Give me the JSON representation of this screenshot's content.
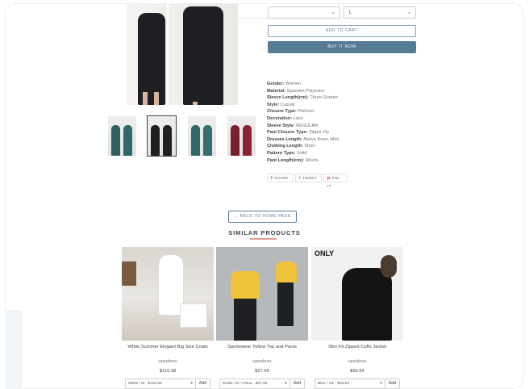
{
  "variant": {
    "color_select": "",
    "size_select": "L"
  },
  "buttons": {
    "add_to_cart": "ADD TO CART",
    "buy_now": "BUY IT NOW",
    "back_to_home": "← BACK TO HOME PAGE"
  },
  "specs": [
    {
      "label": "Gender:",
      "value": "Women"
    },
    {
      "label": "Material:",
      "value": "Spandex,Polyester"
    },
    {
      "label": "Sleeve Length(cm):",
      "value": "Three Quarter"
    },
    {
      "label": "Style:",
      "value": "Casual"
    },
    {
      "label": "Closure Type:",
      "value": "Pullover"
    },
    {
      "label": "Decoration:",
      "value": "Lace"
    },
    {
      "label": "Sleeve Style:",
      "value": "REGULAR"
    },
    {
      "label": "Pant Closure Type:",
      "value": "Zipper Fly"
    },
    {
      "label": "Dresses Length:",
      "value": "Above Knee, Mini"
    },
    {
      "label": "Clothing Length:",
      "value": "Short"
    },
    {
      "label": "Pattern Type:",
      "value": "Solid"
    },
    {
      "label": "Pant Length(cm):",
      "value": "Shorts"
    }
  ],
  "share": [
    {
      "icon": "facebook-icon",
      "glyph": "f",
      "label": "SHARE"
    },
    {
      "icon": "twitter-icon",
      "glyph": "t",
      "label": "TWEET"
    },
    {
      "icon": "pinterest-icon",
      "glyph": "p",
      "label": "PIN IT"
    }
  ],
  "similar": {
    "title": "SIMILAR PRODUCTS",
    "products": [
      {
        "name": "White Summer Elegant Big Size Coats",
        "vendor": "upsalezo",
        "price": "$115.38",
        "option": "White / M - $115.38",
        "add": "Add"
      },
      {
        "name": "Sportswear Yellow Top and Pants",
        "vendor": "upsalezo",
        "price": "$27.60",
        "option": "Khaki / M / China - $27.60",
        "add": "Add"
      },
      {
        "name": "Slim Fit Zipped Cuffs Jacket",
        "vendor": "upsalezo",
        "price": "$96.64",
        "option": "Blue / XS - $96.64",
        "add": "Add",
        "brand": "ONLY"
      }
    ]
  },
  "colors": {
    "accent": "#557b97",
    "underline": "#e29a8e",
    "text": "#3d4246"
  }
}
